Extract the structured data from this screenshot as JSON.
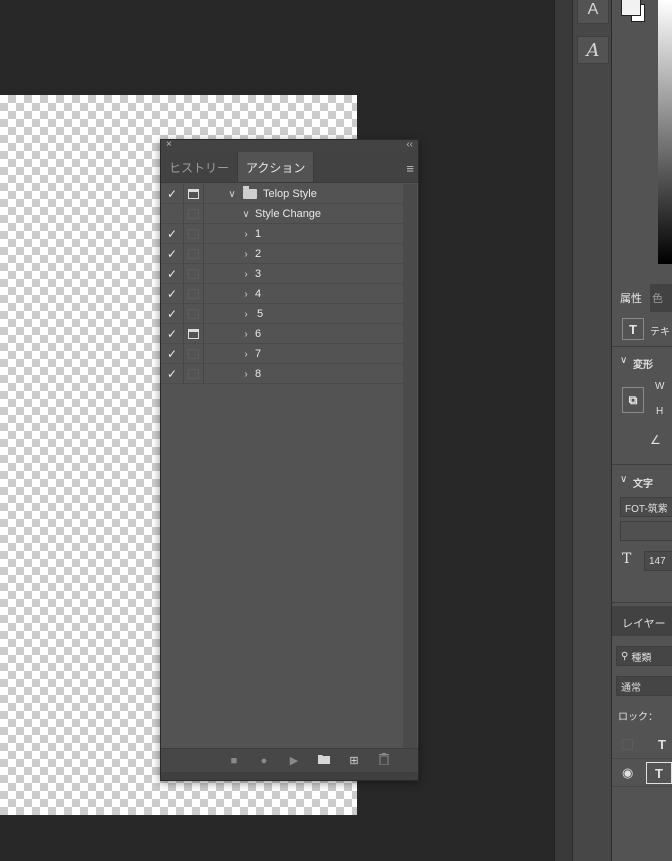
{
  "panel": {
    "close_icon": "×",
    "collapse_icon": "‹‹",
    "menu_icon": "≡",
    "tabs": [
      {
        "label": "ヒストリー",
        "active": false
      },
      {
        "label": "アクション",
        "active": true
      }
    ],
    "rows": [
      {
        "label": "Telop Style",
        "checked": true,
        "dialog": true,
        "expanded": true,
        "type": "set"
      },
      {
        "label": "Style Change",
        "checked": false,
        "dialog": false,
        "expanded": true,
        "type": "action"
      },
      {
        "label": "1",
        "checked": true,
        "dialog": false,
        "expanded": false,
        "type": "step"
      },
      {
        "label": "2",
        "checked": true,
        "dialog": false,
        "expanded": false,
        "type": "step"
      },
      {
        "label": "3",
        "checked": true,
        "dialog": false,
        "expanded": false,
        "type": "step"
      },
      {
        "label": "4",
        "checked": true,
        "dialog": false,
        "expanded": false,
        "type": "step"
      },
      {
        "label": "5",
        "checked": true,
        "dialog": false,
        "expanded": false,
        "type": "step"
      },
      {
        "label": "6",
        "checked": true,
        "dialog": true,
        "expanded": false,
        "type": "step"
      },
      {
        "label": "7",
        "checked": true,
        "dialog": false,
        "expanded": false,
        "type": "step"
      },
      {
        "label": "8",
        "checked": true,
        "dialog": false,
        "expanded": false,
        "type": "step"
      }
    ],
    "footer": {
      "stop_icon": "■",
      "record_icon": "●",
      "play_icon": "▶",
      "new_set_icon": "folder-icon",
      "new_action_icon": "⊞",
      "delete_icon": "trash-icon"
    }
  },
  "right": {
    "tool_glyph_1": "A",
    "tool_glyph_2": "A",
    "props_tab": "属性",
    "color_tab": "色",
    "text_type_label": "テキ",
    "transform_header": "変形",
    "w_label": "W",
    "h_label": "H",
    "text_header": "文字",
    "font_name": "FOT-筑紫",
    "font_size": "147",
    "layers_tab": "レイヤー",
    "layer_kind": "種類",
    "blend_mode": "通常",
    "lock_label": "ロック：",
    "chevron": "∨"
  },
  "colors": {
    "workspace": "#282828",
    "panel": "#535353",
    "panel_dark": "#424242"
  }
}
